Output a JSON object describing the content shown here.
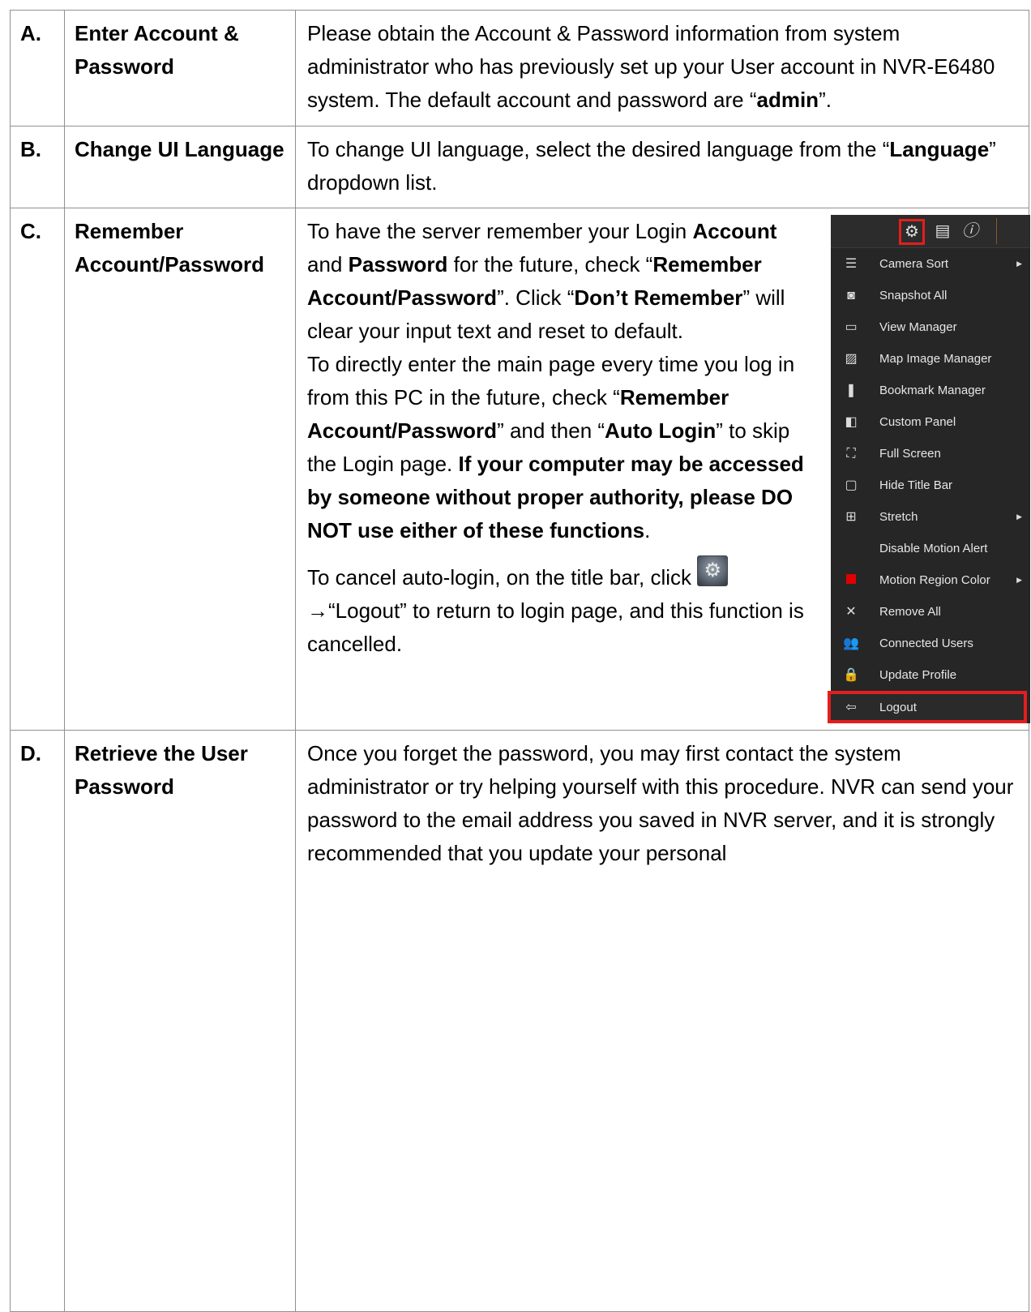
{
  "rows": [
    {
      "letter": "A.",
      "title": "Enter Account & Password",
      "desc": [
        {
          "t": "Please obtain the Account & Password information from system administrator who has previously set up your User account in NVR-E6480 system. The default account and password are “",
          "b": false
        },
        {
          "t": "admin",
          "b": true
        },
        {
          "t": "”.",
          "b": false
        }
      ]
    },
    {
      "letter": "B.",
      "title": "Change UI Language",
      "desc": [
        {
          "t": "To change UI language, select the desired language from the “",
          "b": false
        },
        {
          "t": "Language",
          "b": true
        },
        {
          "t": "” dropdown list.",
          "b": false
        }
      ]
    },
    {
      "letter": "C.",
      "title": "Remember Account/Password",
      "p1": [
        {
          "t": "To have the server remember your Login ",
          "b": false
        },
        {
          "t": "Account",
          "b": true
        },
        {
          "t": " and ",
          "b": false
        },
        {
          "t": "Password",
          "b": true
        },
        {
          "t": " for the future, check “",
          "b": false
        },
        {
          "t": "Remember Account/Password",
          "b": true
        },
        {
          "t": "”. Click “",
          "b": false
        },
        {
          "t": "Don’t Remember",
          "b": true
        },
        {
          "t": "” will clear your input text and reset to default.",
          "b": false
        }
      ],
      "p2": [
        {
          "t": "To directly enter the main page every time you log in from this PC in the future, check “",
          "b": false
        },
        {
          "t": "Remember Account/Password",
          "b": true
        },
        {
          "t": "” and then “",
          "b": false
        },
        {
          "t": "Auto Login",
          "b": true
        },
        {
          "t": "” to skip the Login page. ",
          "b": false
        },
        {
          "t": "If your computer may be accessed by someone without proper authority, please DO NOT use either of these functions",
          "b": true
        },
        {
          "t": ".",
          "b": false
        }
      ],
      "p3a": "To cancel auto-login, on the title bar, click",
      "p3b": "→“Logout” to return to login page, and this function is cancelled.",
      "menu": {
        "items": [
          {
            "label": "Camera Sort",
            "icon": "list-icon",
            "glyph": "☰",
            "arrow": true
          },
          {
            "label": "Snapshot All",
            "icon": "camera-icon",
            "glyph": "◙",
            "arrow": false
          },
          {
            "label": "View Manager",
            "icon": "window-icon",
            "glyph": "▭",
            "arrow": false
          },
          {
            "label": "Map Image Manager",
            "icon": "image-icon",
            "glyph": "▨",
            "arrow": false
          },
          {
            "label": "Bookmark Manager",
            "icon": "bookmark-icon",
            "glyph": "❚",
            "arrow": false
          },
          {
            "label": "Custom Panel",
            "icon": "panel-icon",
            "glyph": "◧",
            "arrow": false
          },
          {
            "label": "Full Screen",
            "icon": "fullscreen-icon",
            "glyph": "⛶",
            "arrow": false
          },
          {
            "label": "Hide Title Bar",
            "icon": "titlebar-icon",
            "glyph": "▢",
            "arrow": false
          },
          {
            "label": "Stretch",
            "icon": "stretch-icon",
            "glyph": "⊞",
            "arrow": true
          },
          {
            "label": "Disable Motion Alert",
            "icon": "",
            "glyph": "",
            "arrow": false
          },
          {
            "label": "Motion Region Color",
            "icon": "color-square-icon",
            "glyph": "red",
            "arrow": true
          },
          {
            "label": "Remove All",
            "icon": "close-icon",
            "glyph": "✕",
            "arrow": false
          },
          {
            "label": "Connected Users",
            "icon": "users-icon",
            "glyph": "👥",
            "arrow": false
          },
          {
            "label": "Update Profile",
            "icon": "lock-icon",
            "glyph": "🔒",
            "arrow": false
          }
        ],
        "logout": {
          "label": "Logout",
          "icon": "logout-icon",
          "glyph": "⇦"
        },
        "toolbar_icons": [
          "gear-icon",
          "document-icon",
          "info-icon"
        ]
      }
    },
    {
      "letter": "D.",
      "title": "Retrieve the User Password",
      "desc": [
        {
          "t": "Once you forget the password, you may first contact the system administrator or try helping yourself with this procedure. NVR can send your password to the email address you saved in NVR server, and it is strongly recommended that you update your personal",
          "b": false
        }
      ]
    }
  ],
  "colors": {
    "highlight": "#e31e1e",
    "menu_bg": "#262626",
    "border": "#909090"
  }
}
